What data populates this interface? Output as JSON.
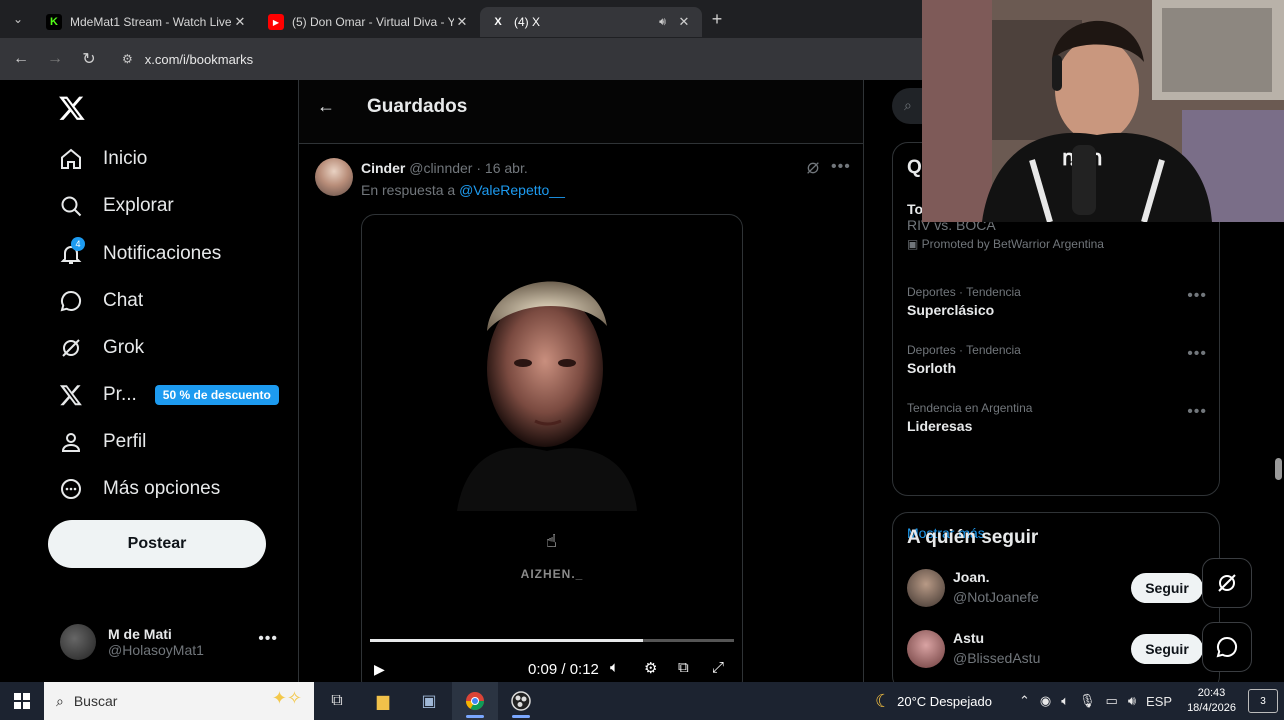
{
  "browser": {
    "tabs": [
      {
        "title": "MdeMat1 Stream - Watch Live",
        "favicon": "K",
        "favicon_color": "#53fc18"
      },
      {
        "title": "(5) Don Omar - Virtual Diva - Yo",
        "favicon": "▶",
        "favicon_color": "#ff0000"
      },
      {
        "title": "(4) X",
        "favicon": "X",
        "favicon_color": "#000000"
      }
    ],
    "url": "x.com/i/bookmarks"
  },
  "nav": {
    "items": [
      {
        "label": "Inicio",
        "icon": "home-icon"
      },
      {
        "label": "Explorar",
        "icon": "search-icon"
      },
      {
        "label": "Notificaciones",
        "icon": "bell-icon",
        "badge": "4"
      },
      {
        "label": "Chat",
        "icon": "chat-icon"
      },
      {
        "label": "Grok",
        "icon": "grok-icon"
      },
      {
        "label": "Pr...",
        "icon": "x-premium-icon",
        "promo": "50 % de descuento"
      },
      {
        "label": "Perfil",
        "icon": "profile-icon"
      },
      {
        "label": "Más opciones",
        "icon": "more-options-icon"
      }
    ],
    "post_label": "Postear",
    "account": {
      "name": "M de Mati",
      "handle": "@HolasoyMat1"
    }
  },
  "main": {
    "title": "Guardados",
    "tweet": {
      "name": "Cinder",
      "handle": "@clinnder",
      "date": "· 16 abr.",
      "reply_prefix": "En respuesta a",
      "reply_to": "@ValeRepetto__",
      "video": {
        "watermark": "AIZHEN._",
        "time": "0:09 / 0:12",
        "progress": 0.75
      }
    }
  },
  "sidebar": {
    "trends_header": "Q",
    "promoted_trend": {
      "head": "To",
      "name": "RIV vs. BOCA",
      "promoted": "Promoted by BetWarrior Argentina"
    },
    "trends": [
      {
        "category": "Deportes · Tendencia",
        "name": "Superclásico"
      },
      {
        "category": "Deportes · Tendencia",
        "name": "Sorloth"
      },
      {
        "category": "Tendencia en Argentina",
        "name": "Lideresas"
      }
    ],
    "show_more": "Mostrar más",
    "follow_header": "A quién seguir",
    "follow": [
      {
        "name": "Joan.",
        "handle": "@NotJoanefe",
        "button": "Seguir"
      },
      {
        "name": "Astu",
        "handle": "@BlissedAstu",
        "button": "Seguir"
      }
    ]
  },
  "taskbar": {
    "search_placeholder": "Buscar",
    "weather": "20°C  Despejado",
    "lang": "ESP",
    "time": "20:43",
    "date": "18/4/2026",
    "notifications": "3"
  },
  "colors": {
    "accent": "#1d9bf0",
    "background": "#000000",
    "border": "#2f3336"
  }
}
